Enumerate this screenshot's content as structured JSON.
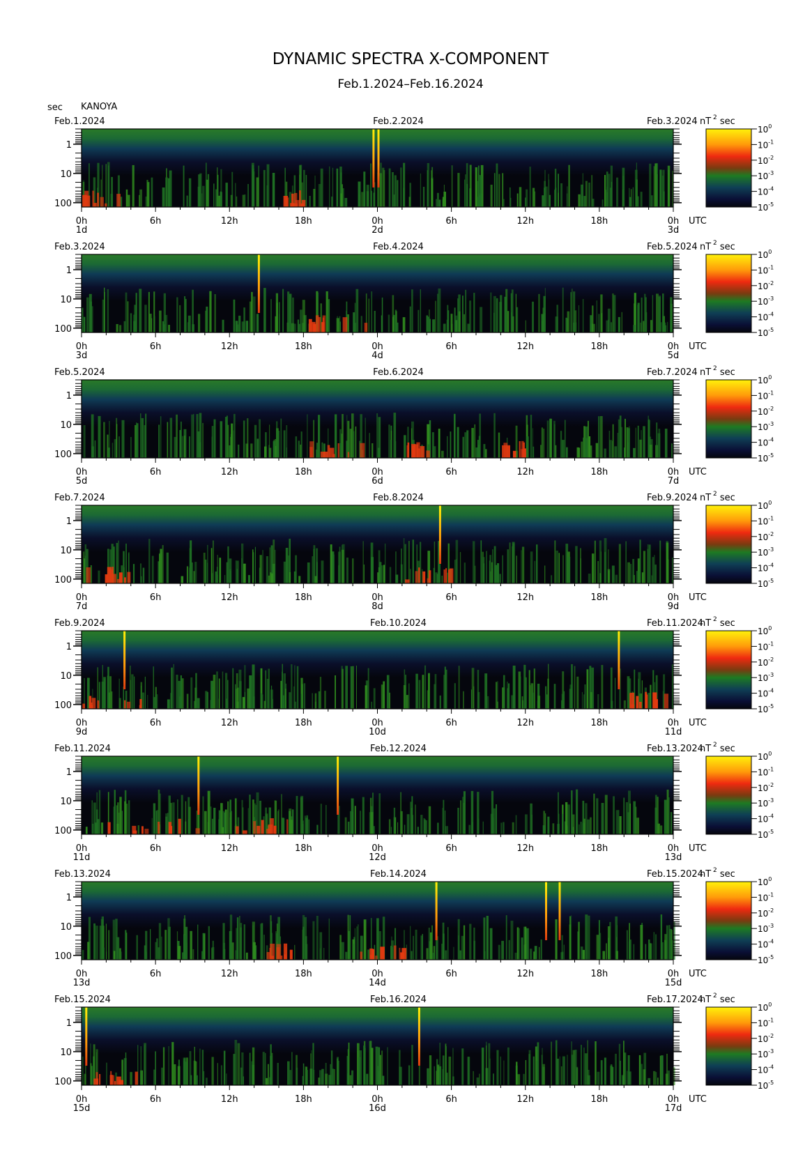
{
  "title": "DYNAMIC SPECTRA X-COMPONENT",
  "subtitle": "Feb.1.2024–Feb.16.2024",
  "y_unit": "sec",
  "station": "KANOYA",
  "colorbar_unit_base": "nT",
  "colorbar_unit_exp": "2",
  "colorbar_unit_tail": "sec",
  "utc_label": "UTC",
  "colors": {
    "background": "#ffffff",
    "quiet_level": "#0a0f2a",
    "noise_level": "#1e6e23",
    "active_level": "#e23a10",
    "spike_level": "#ffe20a"
  },
  "chart_data": {
    "type": "heatmap",
    "x_tick_labels": [
      "0h",
      "6h",
      "12h",
      "18h",
      "0h",
      "6h",
      "12h",
      "18h",
      "0h"
    ],
    "y_tick_labels": [
      "1",
      "10",
      "100"
    ],
    "y_scale": "log",
    "y_axis": "period (sec), inverted",
    "colorbar": {
      "label": "nT^2 sec",
      "scale": "log",
      "ticks": [
        {
          "base": "10",
          "exp": "0"
        },
        {
          "base": "10",
          "exp": "-1"
        },
        {
          "base": "10",
          "exp": "-2"
        },
        {
          "base": "10",
          "exp": "-3"
        },
        {
          "base": "10",
          "exp": "-4"
        },
        {
          "base": "10",
          "exp": "-5"
        }
      ]
    },
    "panels": [
      {
        "left_date": "Feb.1.2024",
        "mid_date": "Feb.2.2024",
        "right_date": "Feb.3.2024",
        "day_labels": [
          "1d",
          "2d",
          "3d"
        ],
        "spikes_h": [
          23.6,
          24.0
        ],
        "active_windows_h": [
          [
            0,
            3
          ],
          [
            16,
            18
          ]
        ]
      },
      {
        "left_date": "Feb.3.2024",
        "mid_date": "Feb.4.2024",
        "right_date": "Feb.5.2024",
        "day_labels": [
          "3d",
          "4d",
          "5d"
        ],
        "spikes_h": [
          14.3
        ],
        "active_windows_h": [
          [
            18,
            24
          ]
        ]
      },
      {
        "left_date": "Feb.5.2024",
        "mid_date": "Feb.6.2024",
        "right_date": "Feb.7.2024",
        "day_labels": [
          "5d",
          "6d",
          "7d"
        ],
        "spikes_h": [],
        "active_windows_h": [
          [
            17,
            23
          ],
          [
            26,
            28
          ],
          [
            34,
            36
          ]
        ]
      },
      {
        "left_date": "Feb.7.2024",
        "mid_date": "Feb.8.2024",
        "right_date": "Feb.9.2024",
        "day_labels": [
          "7d",
          "8d",
          "9d"
        ],
        "spikes_h": [
          29.0
        ],
        "active_windows_h": [
          [
            0,
            4
          ],
          [
            26,
            30
          ]
        ]
      },
      {
        "left_date": "Feb.9.2024",
        "mid_date": "Feb.10.2024",
        "right_date": "Feb.11.2024",
        "day_labels": [
          "9d",
          "10d",
          "11d"
        ],
        "spikes_h": [
          3.4,
          43.5
        ],
        "active_windows_h": [
          [
            0,
            5
          ],
          [
            44,
            48
          ]
        ]
      },
      {
        "left_date": "Feb.11.2024",
        "mid_date": "Feb.12.2024",
        "right_date": "Feb.13.2024",
        "day_labels": [
          "11d",
          "12d",
          "13d"
        ],
        "spikes_h": [
          9.4,
          20.7
        ],
        "active_windows_h": [
          [
            1,
            10
          ],
          [
            12,
            17
          ]
        ]
      },
      {
        "left_date": "Feb.13.2024",
        "mid_date": "Feb.14.2024",
        "right_date": "Feb.15.2024",
        "day_labels": [
          "13d",
          "14d",
          "15d"
        ],
        "spikes_h": [
          28.7,
          37.6,
          38.7
        ],
        "active_windows_h": [
          [
            15,
            17
          ],
          [
            22,
            26
          ]
        ]
      },
      {
        "left_date": "Feb.15.2024",
        "mid_date": "Feb.16.2024",
        "right_date": "Feb.17.2024",
        "day_labels": [
          "15d",
          "16d",
          "17d"
        ],
        "spikes_h": [
          0.3,
          27.3
        ],
        "active_windows_h": [
          [
            0,
            5
          ]
        ]
      }
    ]
  }
}
